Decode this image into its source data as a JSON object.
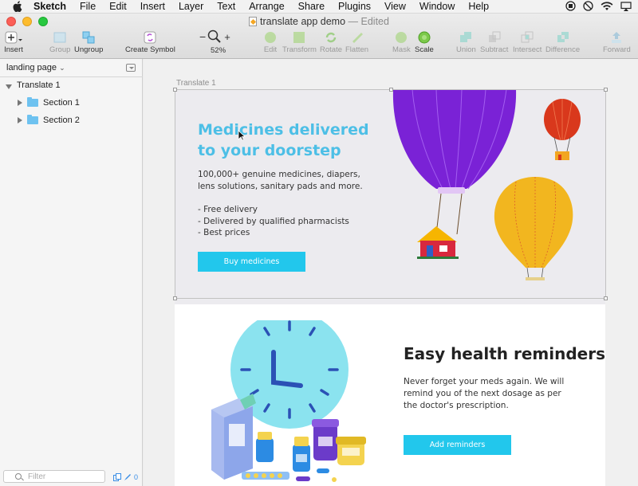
{
  "menubar": {
    "app": "Sketch",
    "items": [
      "File",
      "Edit",
      "Insert",
      "Layer",
      "Text",
      "Arrange",
      "Share",
      "Plugins",
      "View",
      "Window",
      "Help"
    ]
  },
  "window": {
    "title": "translate app demo",
    "edited": "— Edited"
  },
  "toolbar": {
    "insert": "Insert",
    "group": "Group",
    "ungroup": "Ungroup",
    "create_symbol": "Create Symbol",
    "zoom": "52%",
    "edit": "Edit",
    "transform": "Transform",
    "rotate": "Rotate",
    "flatten": "Flatten",
    "mask": "Mask",
    "scale": "Scale",
    "union": "Union",
    "subtract": "Subtract",
    "intersect": "Intersect",
    "difference": "Difference",
    "forward": "Forward"
  },
  "sidebar": {
    "page": "landing page",
    "layers": [
      {
        "label": "Translate 1"
      },
      {
        "label": "Section 1"
      },
      {
        "label": "Section 2"
      }
    ],
    "filter_placeholder": "Filter",
    "badge": "0"
  },
  "canvas": {
    "artboard_label": "Translate 1",
    "section1": {
      "title": "Medicines delivered to your doorstep",
      "text": "100,000+ genuine medicines, diapers, lens solutions, sanitary pads and more.",
      "bullets": [
        "- Free delivery",
        "- Delivered by qualified pharmacists",
        "- Best prices"
      ],
      "button": "Buy medicines"
    },
    "section2": {
      "title": "Easy health reminders",
      "text": "Never forget your meds again. We will remind you of the next dosage as per the doctor's prescription.",
      "button": "Add reminders"
    }
  },
  "colors": {
    "accent": "#22c7ec",
    "headline": "#4dbfe6",
    "balloon_purple": "#7a22d6",
    "balloon_yellow": "#f2b61f",
    "balloon_red": "#d9381c"
  }
}
